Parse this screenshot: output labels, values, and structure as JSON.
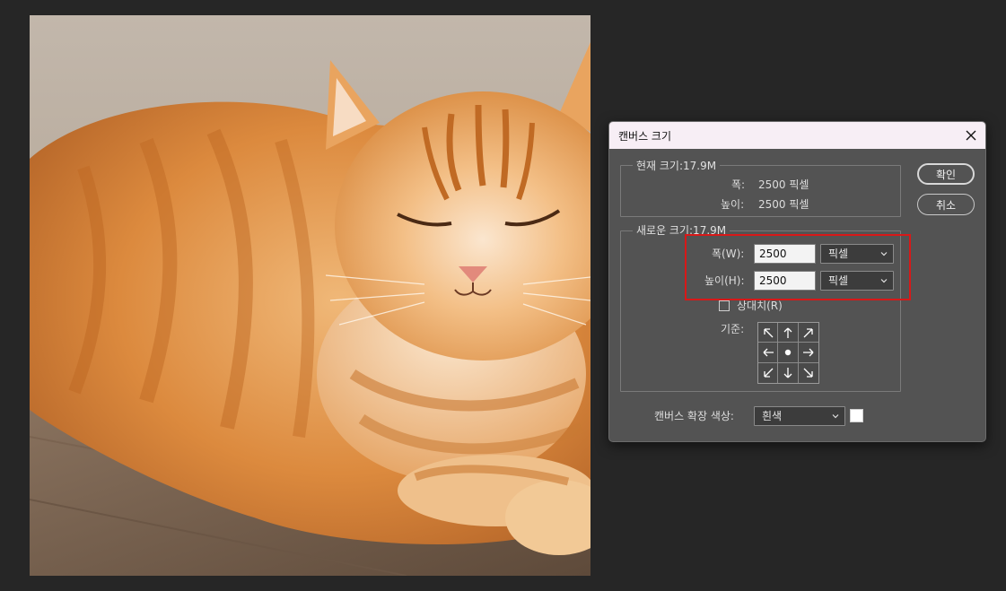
{
  "dialog": {
    "title": "캔버스 크기",
    "current_size": {
      "legend": "현재 크기:17.9M",
      "width_label": "폭:",
      "width_value": "2500 픽셀",
      "height_label": "높이:",
      "height_value": "2500 픽셀"
    },
    "new_size": {
      "legend": "새로운 크기:17.9M",
      "width_label": "폭(W):",
      "width_value": "2500",
      "width_unit": "픽셀",
      "height_label": "높이(H):",
      "height_value": "2500",
      "height_unit": "픽셀",
      "relative_label": "상대치(R)",
      "relative_checked": false,
      "anchor_label": "기준:"
    },
    "extension_color_label": "캔버스 확장 색상:",
    "extension_color_value": "흰색",
    "extension_swatch_color": "#ffffff",
    "ok_label": "확인",
    "cancel_label": "취소",
    "highlight_color": "#d81818"
  },
  "canvas": {
    "subject": "orange tabby cat lying on wooden floor"
  }
}
